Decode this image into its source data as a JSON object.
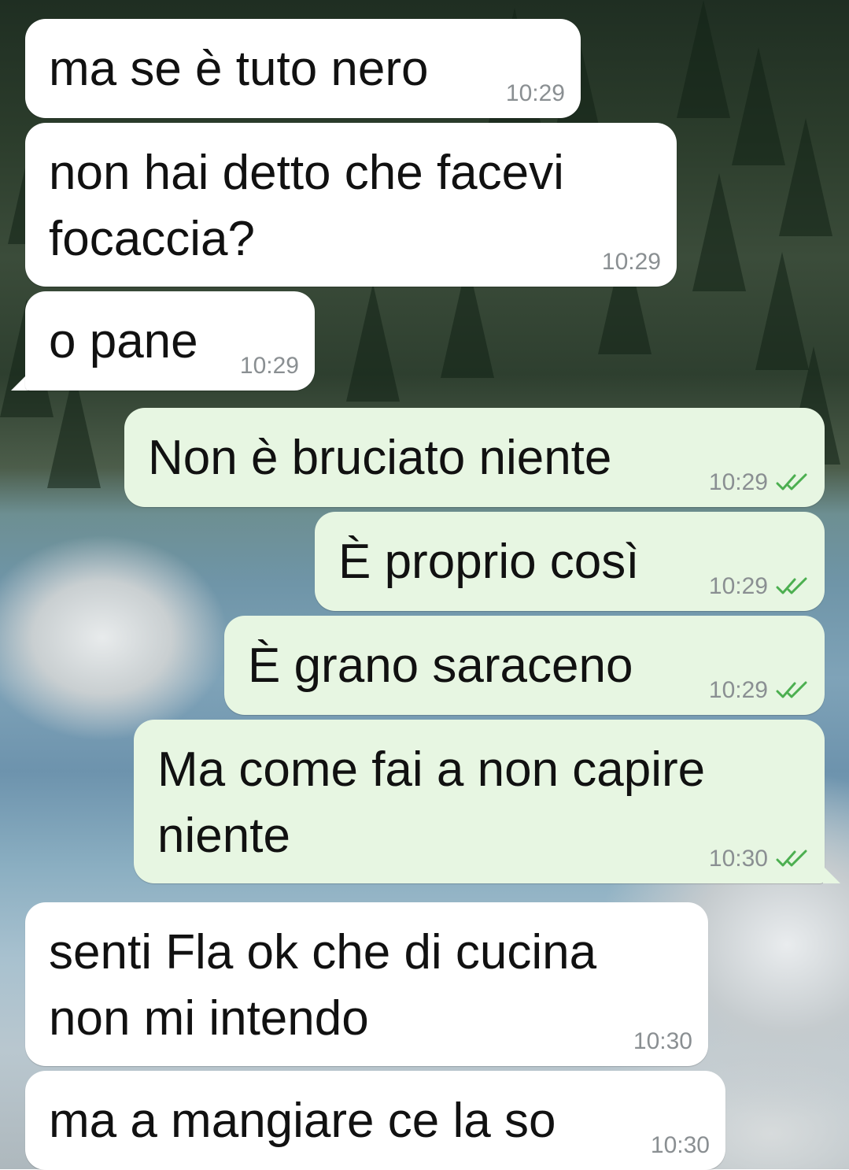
{
  "colors": {
    "incoming_bubble": "#ffffff",
    "outgoing_bubble": "#e7f6e2",
    "read_ticks": "#4caf50",
    "timestamp": "#8a8f92"
  },
  "messages": [
    {
      "direction": "incoming",
      "text": "ma se è tuto nero",
      "time": "10:29"
    },
    {
      "direction": "incoming",
      "text": "non hai detto che facevi\nfocaccia?",
      "time": "10:29"
    },
    {
      "direction": "incoming",
      "text": "o pane",
      "time": "10:29"
    },
    {
      "direction": "outgoing",
      "text": "Non è bruciato niente",
      "time": "10:29",
      "status_icon": "double-check-read-icon"
    },
    {
      "direction": "outgoing",
      "text": "È proprio così",
      "time": "10:29",
      "status_icon": "double-check-read-icon"
    },
    {
      "direction": "outgoing",
      "text": "È grano saraceno",
      "time": "10:29",
      "status_icon": "double-check-read-icon"
    },
    {
      "direction": "outgoing",
      "text": "Ma come fai a non capire\nniente",
      "time": "10:30",
      "status_icon": "double-check-read-icon"
    },
    {
      "direction": "incoming",
      "text": "senti Fla ok che di cucina\nnon mi intendo",
      "time": "10:30"
    },
    {
      "direction": "incoming",
      "text": "ma a mangiare ce la so",
      "time": "10:30"
    }
  ]
}
